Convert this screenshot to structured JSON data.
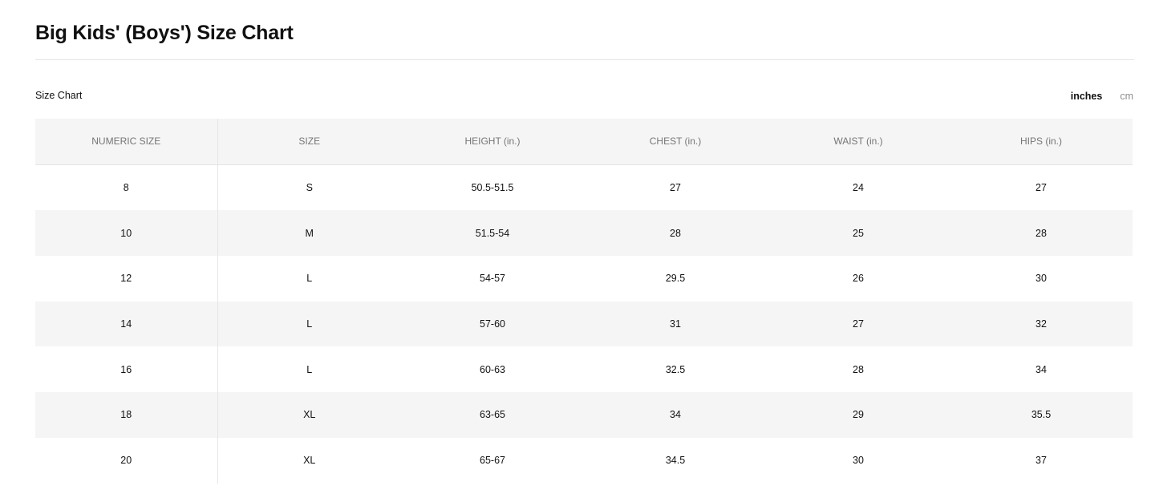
{
  "page": {
    "title": "Big Kids' (Boys') Size Chart"
  },
  "size_chart": {
    "label": "Size Chart",
    "units": {
      "active": "inches",
      "inactive": "cm"
    },
    "columns": [
      "NUMERIC SIZE",
      "SIZE",
      "HEIGHT (in.)",
      "CHEST (in.)",
      "WAIST (in.)",
      "HIPS (in.)"
    ],
    "rows": [
      [
        "8",
        "S",
        "50.5-51.5",
        "27",
        "24",
        "27"
      ],
      [
        "10",
        "M",
        "51.5-54",
        "28",
        "25",
        "28"
      ],
      [
        "12",
        "L",
        "54-57",
        "29.5",
        "26",
        "30"
      ],
      [
        "14",
        "L",
        "57-60",
        "31",
        "27",
        "32"
      ],
      [
        "16",
        "L",
        "60-63",
        "32.5",
        "28",
        "34"
      ],
      [
        "18",
        "XL",
        "63-65",
        "34",
        "29",
        "35.5"
      ],
      [
        "20",
        "XL",
        "65-67",
        "34.5",
        "30",
        "37"
      ]
    ]
  },
  "colors": {
    "text": "#111111",
    "header_text": "#757575",
    "stripe": "#f5f5f5",
    "divider": "#e5e5e5",
    "inactive_unit": "#8d8d8d"
  }
}
